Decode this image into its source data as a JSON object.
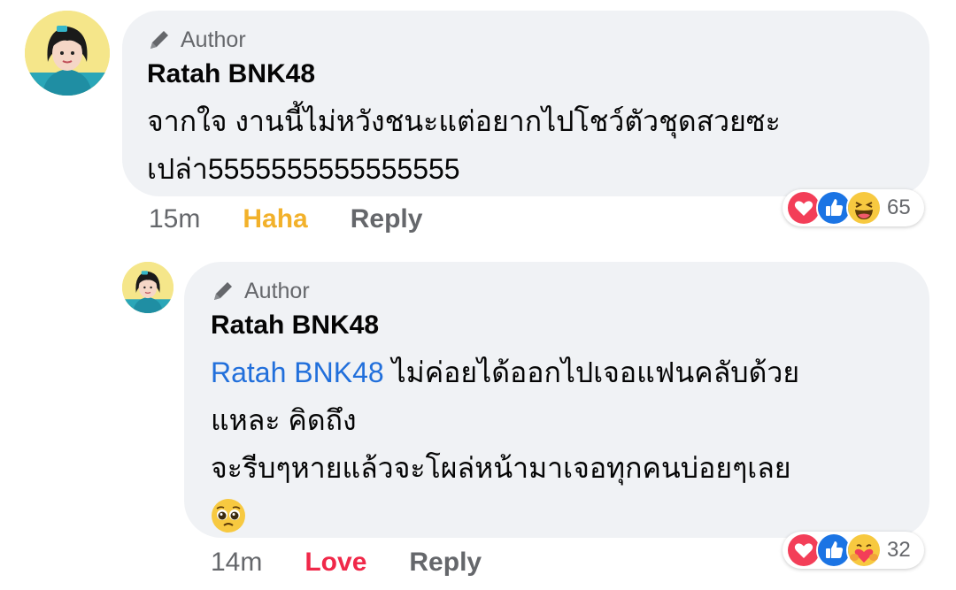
{
  "comments": [
    {
      "author_badge": "Author",
      "name": "Ratah BNK48",
      "text_lines": [
        "จากใจ งานนี้ไม่หวังชนะแต่อยากไปโชว์ตัวชุดสวยซะ",
        "เปล่า5555555555555555"
      ],
      "time": "15m",
      "reaction_label": "Haha",
      "reply_label": "Reply",
      "reactions": [
        "love-icon",
        "like-icon",
        "haha-icon"
      ],
      "reaction_count": "65"
    },
    {
      "author_badge": "Author",
      "name": "Ratah BNK48",
      "mention": "Ratah BNK48",
      "text_after_mention": " ไม่ค่อยได้ออกไปเจอแฟนคลับด้วย",
      "text_lines": [
        "แหละ คิดถึง",
        "จะรีบๆหายแล้วจะโผล่หน้ามาเจอทุกคนบ่อยๆเลย"
      ],
      "emoji": "🥺",
      "time": "14m",
      "reaction_label": "Love",
      "reply_label": "Reply",
      "reactions": [
        "love-icon",
        "like-icon",
        "care-icon"
      ],
      "reaction_count": "32"
    }
  ],
  "colors": {
    "bubble": "#f0f2f5",
    "meta": "#65676b",
    "haha": "#f2b12a",
    "love": "#f02849",
    "mention": "#216fdb"
  }
}
